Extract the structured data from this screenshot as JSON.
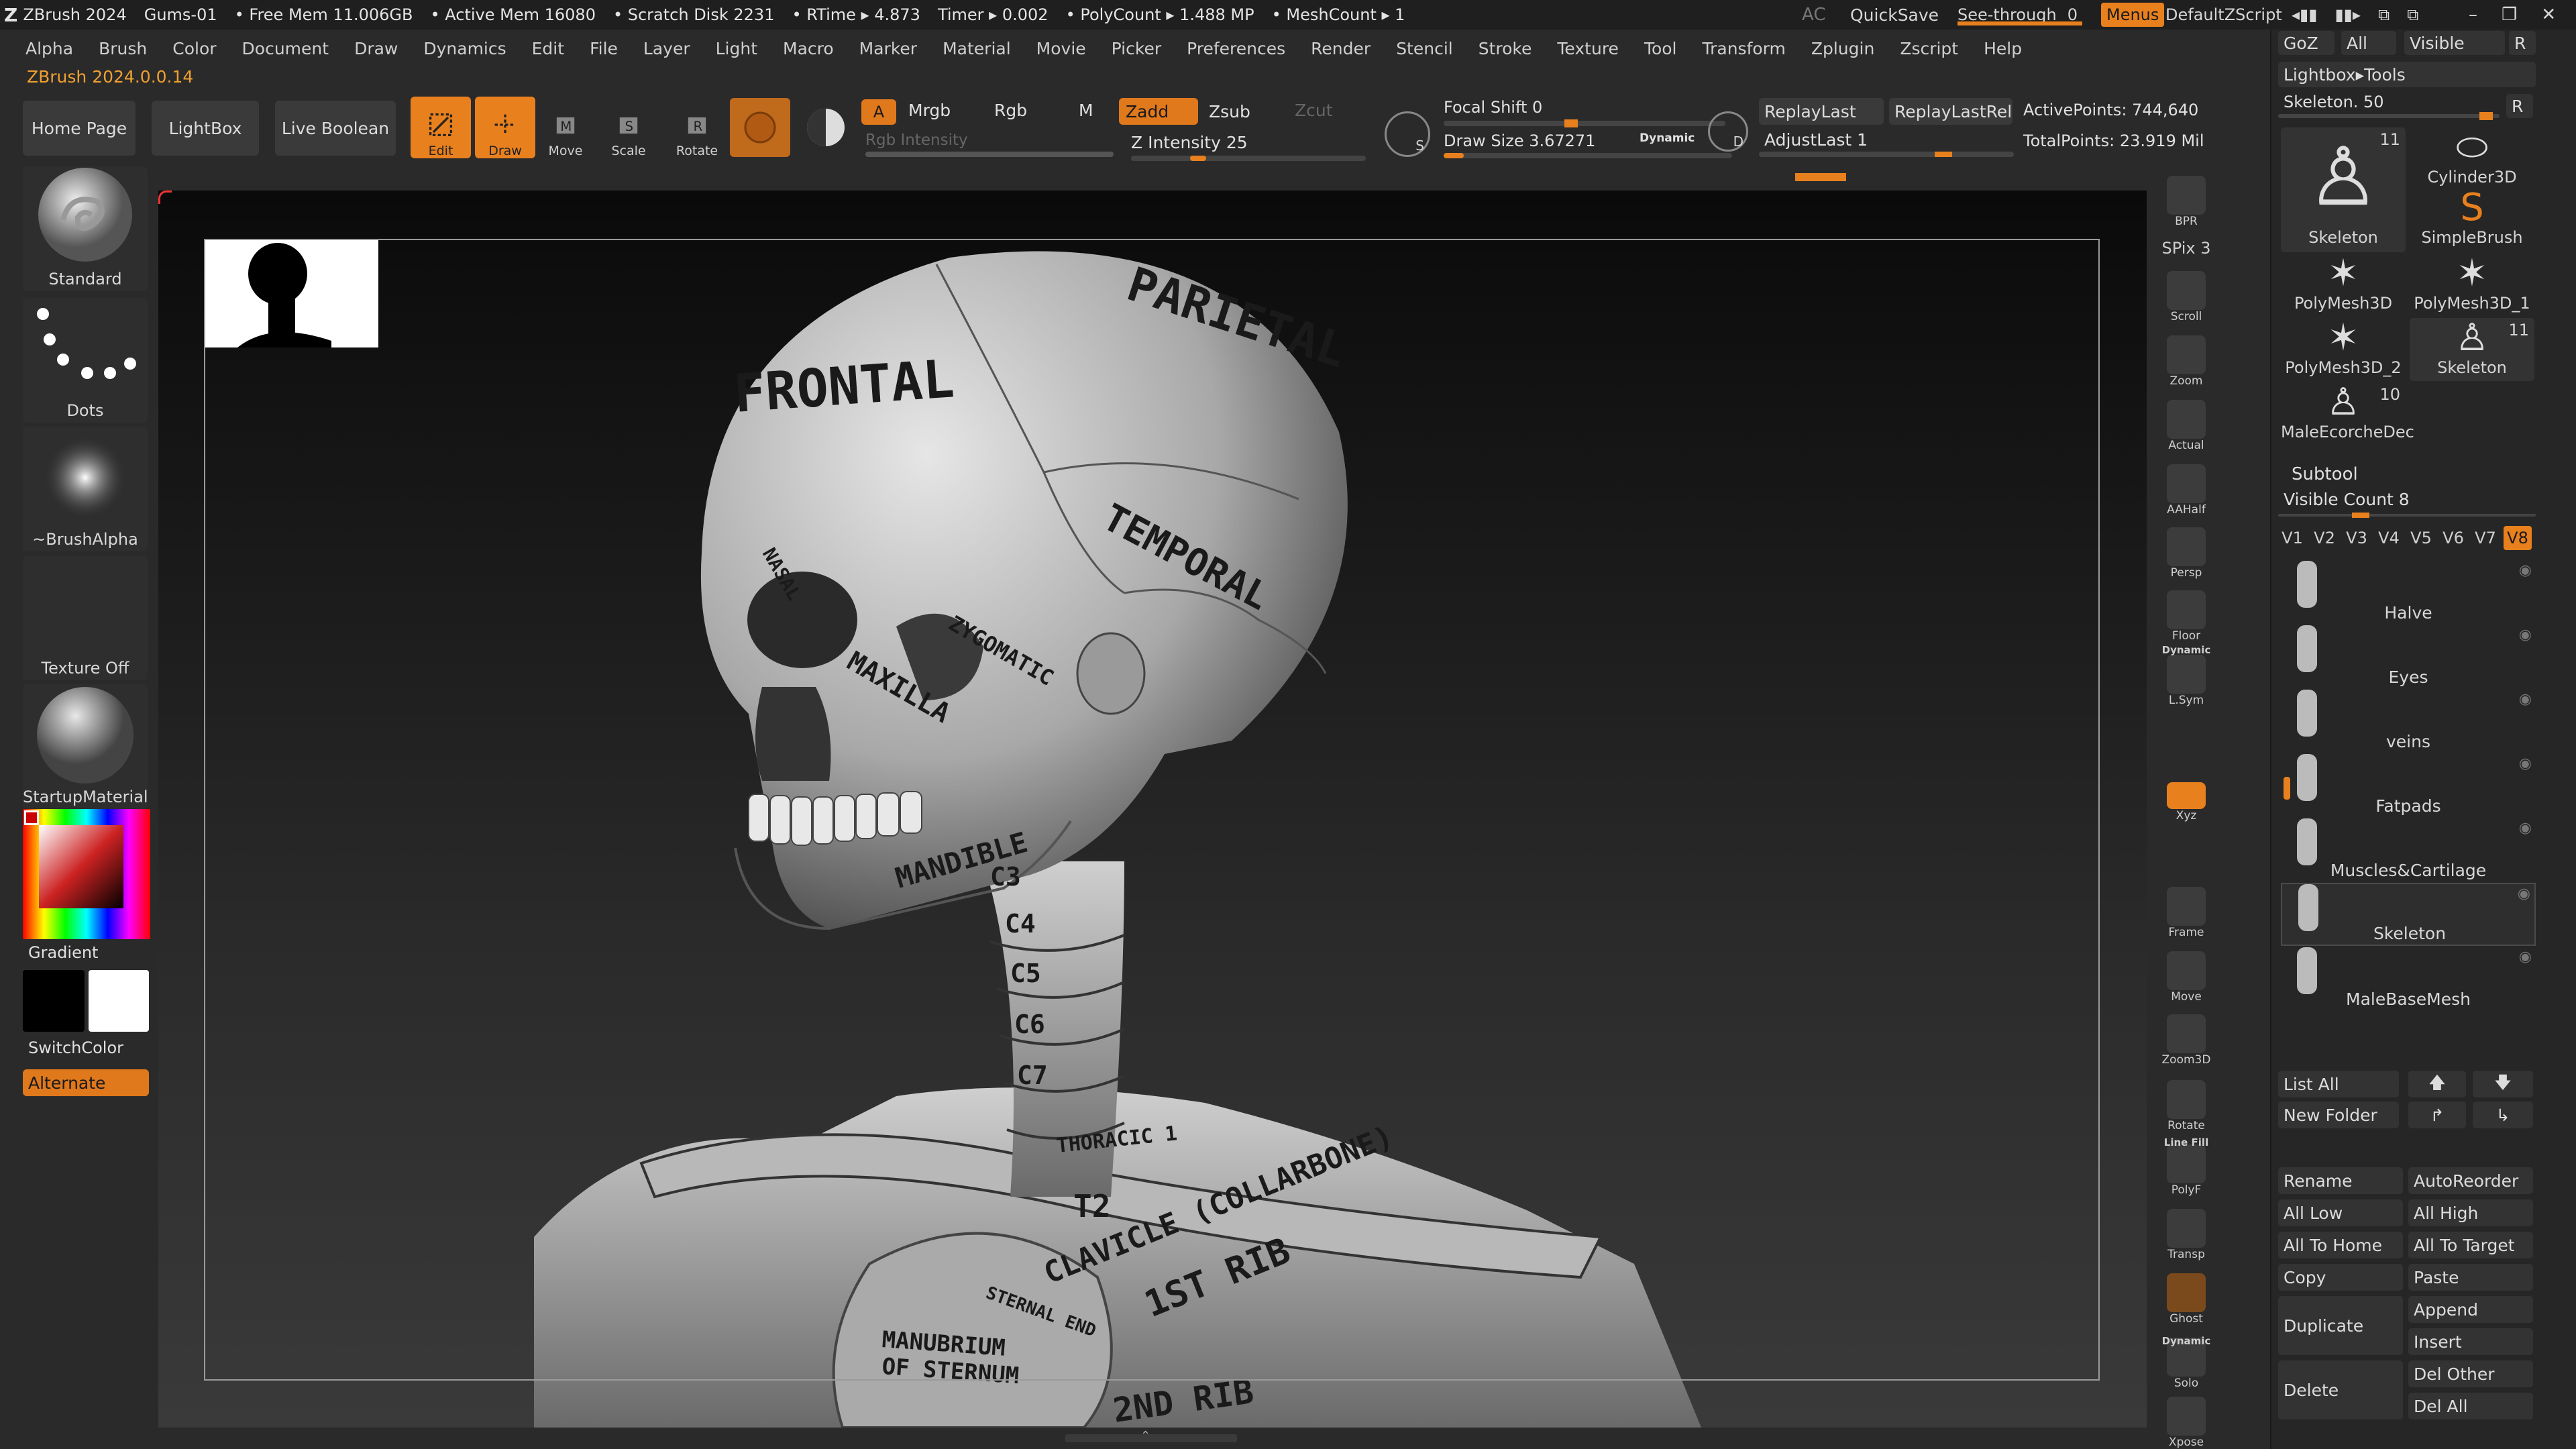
{
  "titlebar": {
    "app": "ZBrush 2024",
    "doc": "Gums-01",
    "free_mem": "• Free Mem 11.006GB",
    "active_mem": "• Active Mem 16080",
    "scratch": "• Scratch Disk 2231",
    "rtime": "• RTime ▸ 4.873",
    "timer": "Timer ▸ 0.002",
    "polycount": "• PolyCount ▸ 1.488 MP",
    "meshcount": "• MeshCount ▸ 1",
    "ac": "AC",
    "quicksave": "QuickSave",
    "seethrough": "See-through",
    "seethrough_value": "0",
    "menus": "Menus",
    "script": "DefaultZScript"
  },
  "menubar": [
    "Alpha",
    "Brush",
    "Color",
    "Document",
    "Draw",
    "Dynamics",
    "Edit",
    "File",
    "Layer",
    "Light",
    "Macro",
    "Marker",
    "Material",
    "Movie",
    "Picker",
    "Preferences",
    "Render",
    "Stencil",
    "Stroke",
    "Texture",
    "Tool",
    "Transform",
    "Zplugin",
    "Zscript",
    "Help"
  ],
  "version": "ZBrush 2024.0.0.14",
  "toolbar": {
    "home": "Home Page",
    "lightbox": "LightBox",
    "liveboolean": "Live Boolean",
    "edit": "Edit",
    "draw": "Draw",
    "move": "Move",
    "scale": "Scale",
    "rotate": "Rotate",
    "a": "A",
    "mrgb": "Mrgb",
    "rgb": "Rgb",
    "m": "M",
    "zadd": "Zadd",
    "zsub": "Zsub",
    "zcut": "Zcut",
    "rgb_intensity": "Rgb Intensity",
    "z_intensity": "Z Intensity 25",
    "z_intensity_value": 25,
    "focal_shift": "Focal Shift 0",
    "draw_size": "Draw Size 3.67271",
    "dynamic": "Dynamic",
    "replaylast": "ReplayLast",
    "replaylastrel": "ReplayLastRel",
    "adjustlast": "AdjustLast 1",
    "active_points": "ActivePoints: 744,640",
    "total_points": "TotalPoints: 23.919 Mil",
    "s_label": "S",
    "d_label": "D"
  },
  "left_shelf": {
    "standard": "Standard",
    "dots": "Dots",
    "brushalpha": "~BrushAlpha",
    "texture": "Texture Off",
    "material": "StartupMaterial",
    "gradient": "Gradient",
    "switchcolor": "SwitchColor",
    "alternate": "Alternate"
  },
  "skull_labels": {
    "frontal": "FRONTAL",
    "parietal": "PARIETAL",
    "temporal": "TEMPORAL",
    "zygomatic": "ZYGOMATIC",
    "maxilla": "MAXILLA",
    "mandible": "MANDIBLE",
    "nasal": "NASAL",
    "c3": "C3",
    "c4": "C4",
    "c5": "C5",
    "c6": "C6",
    "c7": "C7",
    "thoracic": "THORACIC 1",
    "t2": "T2",
    "clavicle": "CLAVICLE (COLLARBONE)",
    "first_rib": "1ST RIB",
    "sternal": "STERNAL END",
    "manubrium": "MANUBRIUM",
    "of_sternum": "OF STERNUM",
    "second_rib": "2ND RIB"
  },
  "right_shelf": [
    "BPR",
    "SPix 3",
    "Scroll",
    "Zoom",
    "Actual",
    "AAHalf",
    "Persp",
    "Floor",
    "L.Sym",
    "",
    "Xyz",
    "",
    "",
    "Frame",
    "Move",
    "Zoom3D",
    "Rotate",
    "PolyF",
    "Transp",
    "Ghost",
    "Solo",
    "Xpose"
  ],
  "right_shelf_extra": {
    "dynamic": "Dynamic",
    "linefill": "Line Fill"
  },
  "panel": {
    "goz": "GoZ",
    "all": "All",
    "visible": "Visible",
    "r": "R",
    "lightbox_tools": "Lightbox▸Tools",
    "skeleton_slider": "Skeleton. 50",
    "thumbs": [
      {
        "name": "Skeleton",
        "count": "11"
      },
      {
        "name": "Cylinder3D",
        "count": ""
      },
      {
        "name": "SimpleBrush",
        "count": ""
      },
      {
        "name": "PolyMesh3D",
        "count": ""
      },
      {
        "name": "PolyMesh3D_1",
        "count": ""
      },
      {
        "name": "PolyMesh3D_2",
        "count": ""
      },
      {
        "name": "Skeleton",
        "count": "11"
      },
      {
        "name": "MaleEcorcheDec",
        "count": "10"
      }
    ],
    "subtool": "Subtool",
    "visible_count": "Visible Count 8",
    "versions": [
      "V1",
      "V2",
      "V3",
      "V4",
      "V5",
      "V6",
      "V7",
      "V8"
    ],
    "subtools": [
      "Halve",
      "Eyes",
      "veins",
      "Fatpads",
      "Muscles&Cartilage",
      "Skeleton",
      "MaleBaseMesh"
    ],
    "listall": "List All",
    "newfolder": "New Folder",
    "rename": "Rename",
    "autoreorder": "AutoReorder",
    "alllow": "All Low",
    "allhigh": "All High",
    "alltohome": "All To Home",
    "alltotarget": "All To Target",
    "copy": "Copy",
    "paste": "Paste",
    "duplicate": "Duplicate",
    "append": "Append",
    "insert": "Insert",
    "delete": "Delete",
    "delother": "Del Other",
    "delall": "Del All"
  },
  "colors": {
    "accent": "#e8801e",
    "bg": "#2a2a2a",
    "panel": "#262626"
  }
}
